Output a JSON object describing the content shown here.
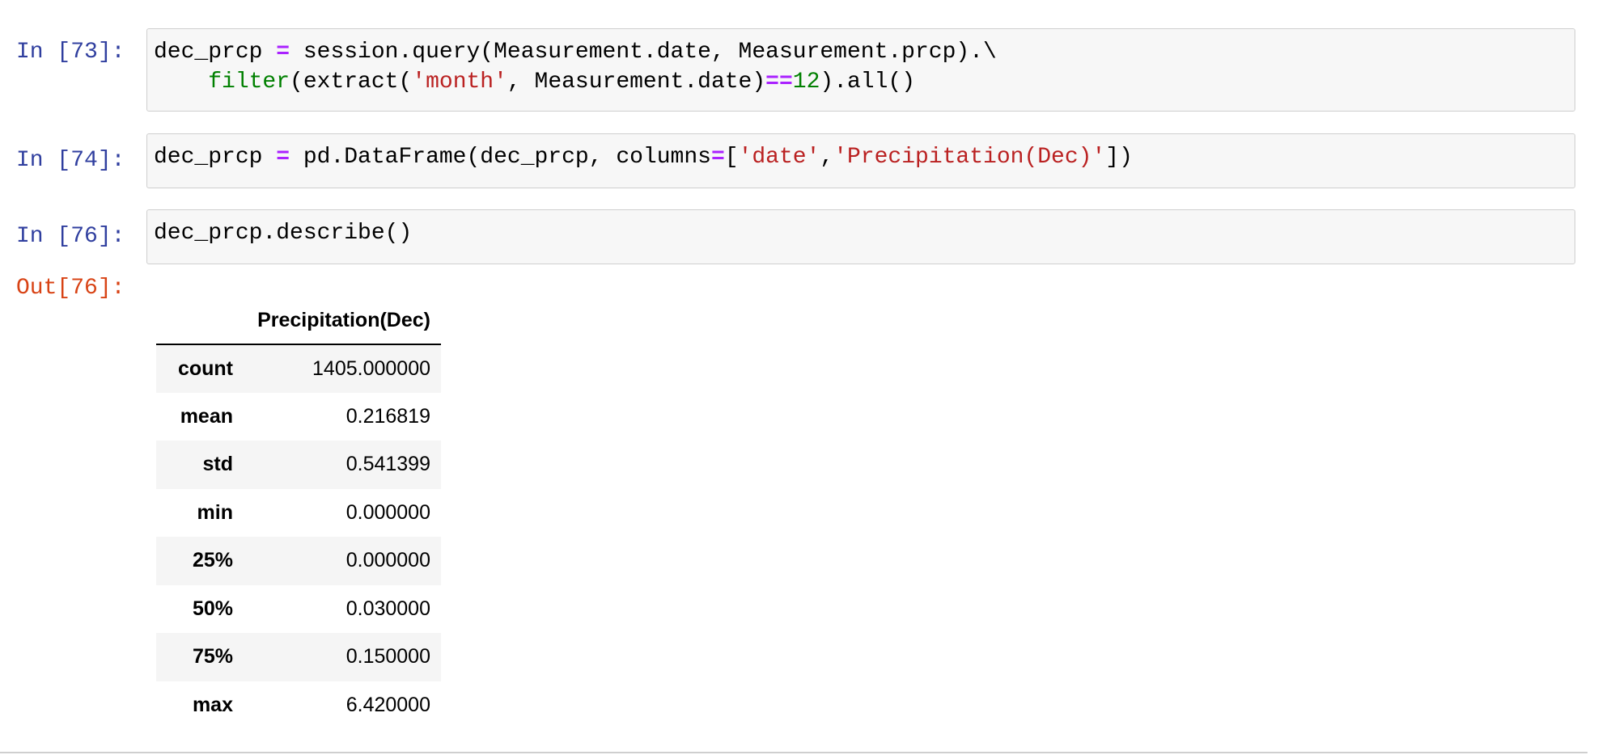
{
  "cells": [
    {
      "prompt": "In [73]:",
      "code": {
        "line1": {
          "t1": "dec_prcp ",
          "op1": "=",
          "t2": " session.query(Measurement.date, Measurement.prcp).\\"
        },
        "line2": {
          "indent": "    ",
          "fn": "filter",
          "t1": "(extract(",
          "str1": "'month'",
          "t2": ", Measurement.date)",
          "op1": "==",
          "num1": "12",
          "t3": ").all()"
        }
      }
    },
    {
      "prompt": "In [74]:",
      "code": {
        "line1": {
          "t1": "dec_prcp ",
          "op1": "=",
          "t2": " pd.DataFrame(dec_prcp, columns",
          "op2": "=",
          "t3": "[",
          "str1": "'date'",
          "t4": ",",
          "str2": "'Precipitation(Dec)'",
          "t5": "])"
        }
      }
    },
    {
      "prompt": "In [76]:",
      "code": {
        "line1": {
          "t1": "dec_prcp.describe()"
        }
      },
      "out_prompt": "Out[76]:"
    }
  ],
  "table": {
    "header": [
      "",
      "Precipitation(Dec)"
    ],
    "rows": [
      {
        "label": "count",
        "value": "1405.000000"
      },
      {
        "label": "mean",
        "value": "0.216819"
      },
      {
        "label": "std",
        "value": "0.541399"
      },
      {
        "label": "min",
        "value": "0.000000"
      },
      {
        "label": "25%",
        "value": "0.000000"
      },
      {
        "label": "50%",
        "value": "0.030000"
      },
      {
        "label": "75%",
        "value": "0.150000"
      },
      {
        "label": "max",
        "value": "6.420000"
      }
    ]
  },
  "colors": {
    "prompt_in": "#303f9f",
    "prompt_out": "#d84315",
    "operator": "#aa22ff",
    "string": "#ba2121",
    "number": "#008000",
    "builtin": "#008000"
  }
}
